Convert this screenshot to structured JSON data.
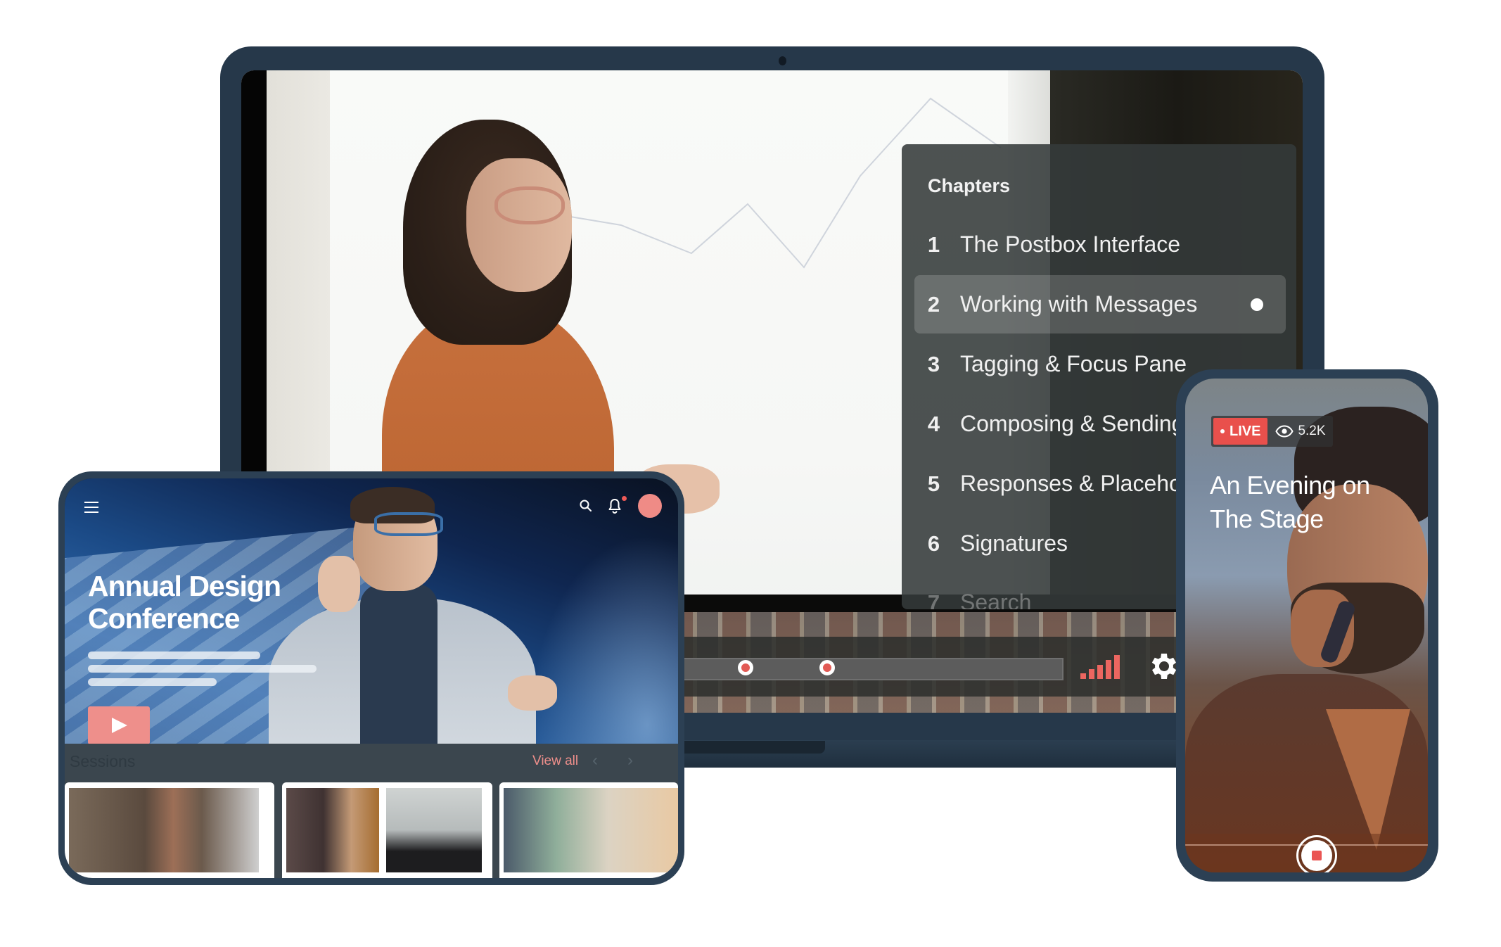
{
  "laptop": {
    "chapters": {
      "title": "Chapters",
      "items": [
        {
          "number": "1",
          "label": "The Postbox Interface",
          "active": false
        },
        {
          "number": "2",
          "label": "Working with Messages",
          "active": true
        },
        {
          "number": "3",
          "label": "Tagging & Focus Pane",
          "active": false
        },
        {
          "number": "4",
          "label": "Composing & Sending",
          "active": false
        },
        {
          "number": "5",
          "label": "Responses & Placehol",
          "active": false
        },
        {
          "number": "6",
          "label": "Signatures",
          "active": false
        },
        {
          "number": "7",
          "label": "Search",
          "active": false
        }
      ]
    },
    "player": {
      "chapter_marker_count": 4,
      "signal_icon": "signal-strength-icon",
      "settings_icon": "gear-icon",
      "accent_color": "#e25a55"
    }
  },
  "tablet": {
    "header": {
      "menu_icon": "hamburger-menu-icon",
      "search_icon": "search-icon",
      "notification_icon": "bell-icon",
      "avatar_color": "#ef8b86"
    },
    "hero": {
      "title_line1": "Annual Design",
      "title_line2": "Conference",
      "play_icon": "play-icon",
      "carousel_pages": 4,
      "carousel_active": 1
    },
    "sessions": {
      "title": "Sessions",
      "view_all": "View all",
      "prev": "‹",
      "next": "›"
    }
  },
  "phone": {
    "live_label": "LIVE",
    "viewer_count": "5.2K",
    "title_line1": "An Evening on",
    "title_line2": "The Stage",
    "record_icon": "stop-record-icon",
    "live_color": "#e9504c"
  }
}
